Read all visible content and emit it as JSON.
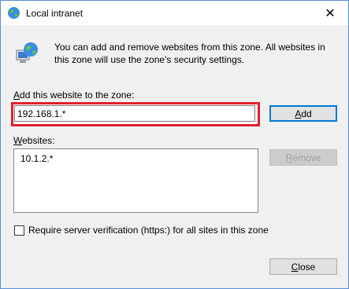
{
  "window": {
    "title": "Local intranet",
    "close_glyph": "✕"
  },
  "info": {
    "icon": "intranet-globe-computer-icon",
    "text": "You can add and remove websites from this zone. All websites in this zone will use the zone's security settings."
  },
  "add_section": {
    "label_prefix": "A",
    "label_rest": "dd this website to the zone:",
    "input_value": "192.168.1.*",
    "add_button_mnemonic": "A",
    "add_button_rest": "dd"
  },
  "websites_section": {
    "label_mnemonic": "W",
    "label_rest": "ebsites:",
    "items": [
      "10.1.2.*"
    ],
    "remove_button_mnemonic": "R",
    "remove_button_rest": "emove"
  },
  "require_https": {
    "checked": false,
    "label": "Require server verification (https:) for all sites in this zone"
  },
  "footer": {
    "close_button_mnemonic": "C",
    "close_button_rest": "lose"
  },
  "colors": {
    "highlight": "#e0202e",
    "accent": "#0078d7"
  }
}
